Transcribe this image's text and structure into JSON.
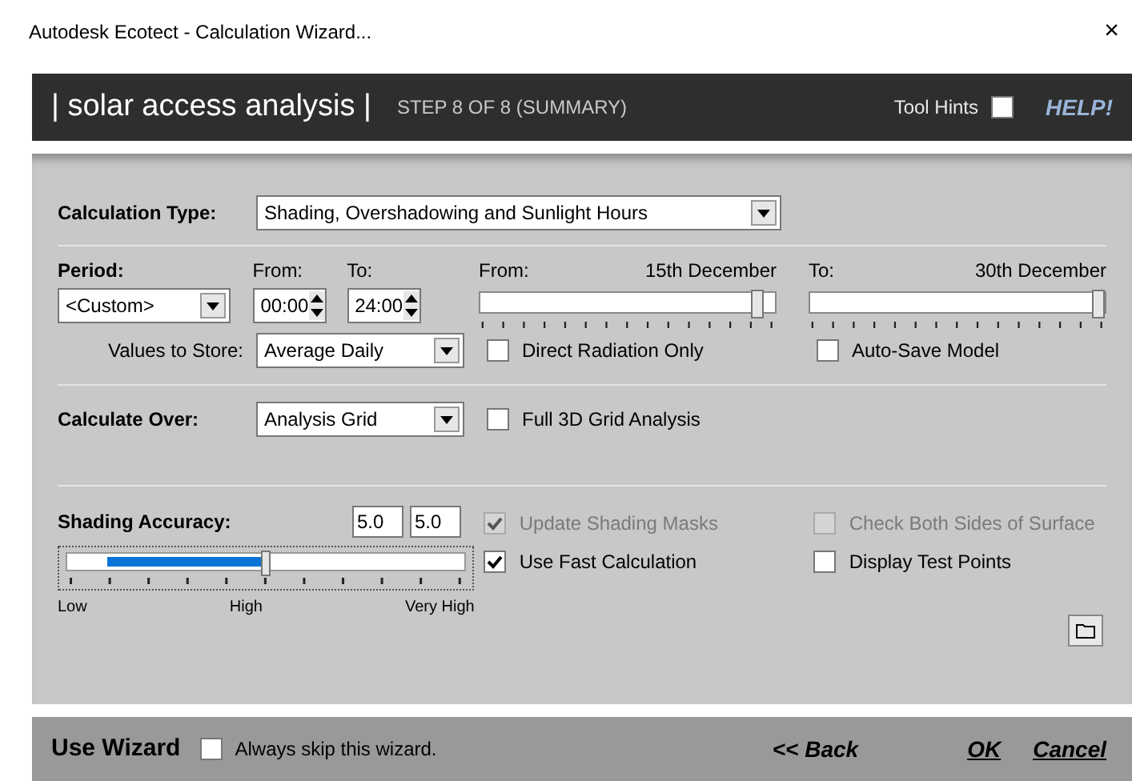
{
  "window": {
    "title": "Autodesk Ecotect - Calculation Wizard...",
    "close": "×"
  },
  "header": {
    "title": "| solar access analysis |",
    "step": "STEP 8 OF 8  (SUMMARY)",
    "tool_hints": {
      "label": "Tool Hints",
      "checked": false
    },
    "help": "HELP!"
  },
  "calculation_type": {
    "label": "Calculation Type:",
    "value": "Shading, Overshadowing and Sunlight Hours"
  },
  "period": {
    "label": "Period:",
    "value": "<Custom>",
    "from_label": "From:",
    "from": "00:00",
    "to_label": "To:",
    "to": "24:00"
  },
  "date_sliders": [
    {
      "label": "From:",
      "reading": "15th December",
      "level": 0.96
    },
    {
      "label": "To:",
      "reading": "30th December",
      "level": 1
    }
  ],
  "values_to_store": {
    "label": "Values to Store:",
    "value": "Average Daily"
  },
  "options_row1": [
    {
      "label": "Direct Radiation Only",
      "checked": false,
      "disabled": false
    },
    {
      "label": "Auto-Save Model",
      "checked": false,
      "disabled": false
    }
  ],
  "calculate_over": {
    "label": "Calculate Over:",
    "value": "Analysis Grid",
    "option": {
      "label": "Full 3D Grid Analysis",
      "checked": false,
      "disabled": false
    }
  },
  "shading_accuracy": {
    "label": "Shading Accuracy:",
    "values": [
      "5.0",
      "5.0"
    ],
    "level": 0.5,
    "ticks": [
      "Low",
      "High",
      "Very High"
    ]
  },
  "shading_options": [
    {
      "label": "Update Shading Masks",
      "checked": true,
      "disabled": true
    },
    {
      "label": "Check Both Sides of Surface",
      "checked": false,
      "disabled": true
    },
    {
      "label": "Use Fast Calculation",
      "checked": true,
      "disabled": false
    },
    {
      "label": "Display Test Points",
      "checked": false,
      "disabled": false
    }
  ],
  "footer": {
    "title": "Use Wizard",
    "skip": {
      "label": "Always skip this wizard.",
      "checked": false
    },
    "back": "<< Back",
    "ok": "OK",
    "cancel": "Cancel"
  }
}
